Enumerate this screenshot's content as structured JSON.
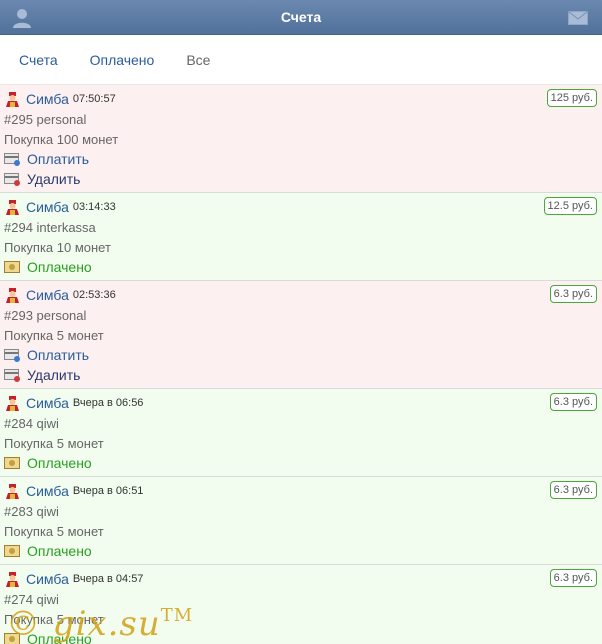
{
  "header": {
    "title": "Счета",
    "left_icon": "user-icon",
    "right_icon": "envelope-icon"
  },
  "tabs": [
    {
      "label": "Счета"
    },
    {
      "label": "Оплачено"
    },
    {
      "label": "Все"
    }
  ],
  "colors": {
    "header": "#5b7ba4",
    "pink_row": "#fdf0f0",
    "green_row": "#f2fdf0",
    "link": "#2a5d9a",
    "paid": "#28a020",
    "badge_border": "#4aa83a"
  },
  "items": [
    {
      "user": "Симба",
      "time": "07:50:57",
      "number": "#295 personal",
      "description": "Покупка 100 монет",
      "amount": "125 руб.",
      "pay": "Оплатить",
      "delete": "Удалить"
    },
    {
      "user": "Симба",
      "time": "03:14:33",
      "number": "#294 interkassa",
      "description": "Покупка 10 монет",
      "amount": "12.5 руб.",
      "status": "Оплачено"
    },
    {
      "user": "Симба",
      "time": "02:53:36",
      "number": "#293 personal",
      "description": "Покупка 5 монет",
      "amount": "6.3 руб.",
      "pay": "Оплатить",
      "delete": "Удалить"
    },
    {
      "user": "Симба",
      "time": "Вчера в 06:56",
      "number": "#284 qiwi",
      "description": "Покупка 5 монет",
      "amount": "6.3 руб.",
      "status": "Оплачено"
    },
    {
      "user": "Симба",
      "time": "Вчера в 06:51",
      "number": "#283 qiwi",
      "description": "Покупка 5 монет",
      "amount": "6.3 руб.",
      "status": "Оплачено"
    },
    {
      "user": "Симба",
      "time": "Вчера в 04:57",
      "number": "#274 qiwi",
      "description": "Покупка 5 монет",
      "amount": "6.3 руб.",
      "status": "Оплачено"
    }
  ],
  "watermark": {
    "text": "© gix.su",
    "mark": "TM"
  }
}
